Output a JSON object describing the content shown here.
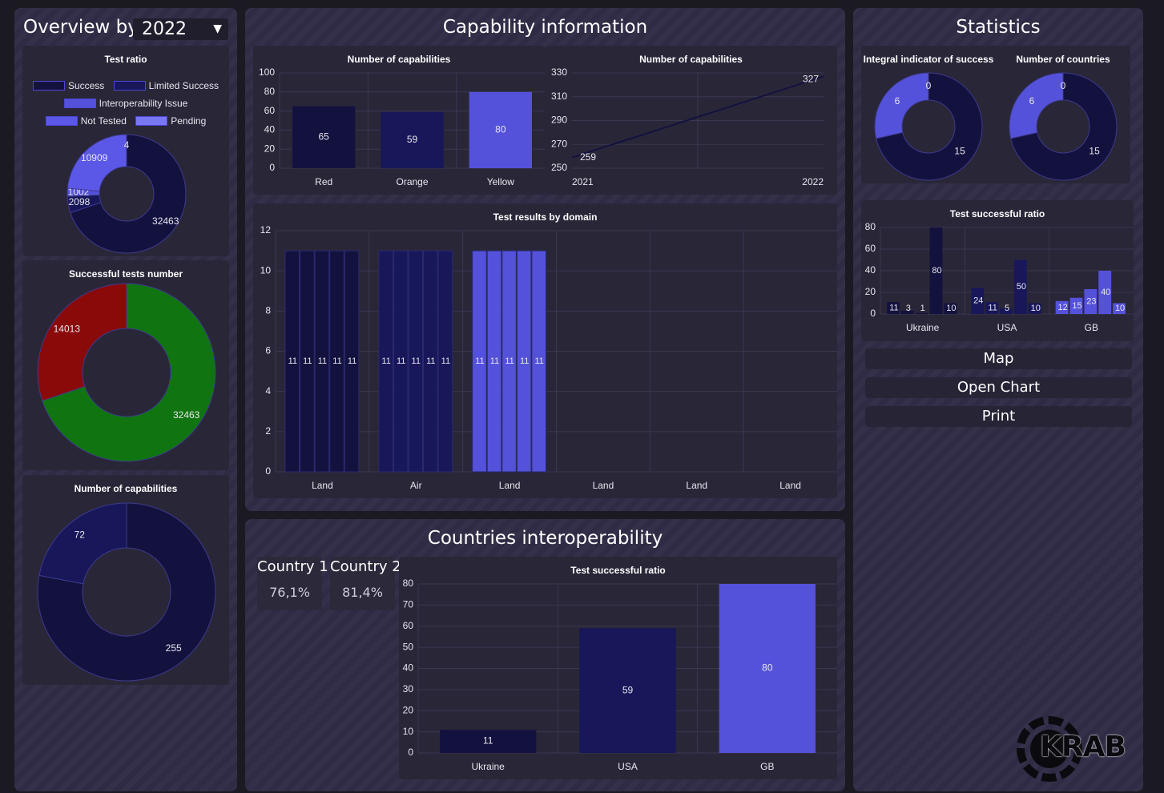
{
  "left": {
    "overview_label": "Overview by",
    "year": "2022"
  },
  "capability": {
    "title": "Capability information"
  },
  "countries": {
    "title": "Countries interoperability",
    "kpis": [
      {
        "label": "Country 1",
        "value": "76,1%"
      },
      {
        "label": "Country 2",
        "value": "81,4%"
      }
    ]
  },
  "statistics": {
    "title": "Statistics",
    "buttons": {
      "map": "Map",
      "open_chart": "Open Chart",
      "print": "Print"
    }
  },
  "logo": {
    "text": "KRAB"
  },
  "colors": {
    "dark_navy": "#13123f",
    "navy": "#17175a",
    "purple": "#5452da",
    "light_purple": "#6a67f0",
    "green": "#107510",
    "red": "#8a0a0a"
  },
  "chart_data": [
    {
      "id": "test_ratio",
      "type": "pie",
      "title": "Test ratio",
      "legend": [
        "Success",
        "Limited Success",
        "Interoperability Issue",
        "Not Tested",
        "Pending"
      ],
      "labels": [
        "Success",
        "Limited Success",
        "Interoperability Issue",
        "Not Tested",
        "Pending"
      ],
      "values": [
        32463,
        2098,
        1002,
        10909,
        4
      ],
      "colors": [
        "#13123f",
        "#17175a",
        "#5452da",
        "#5b58e8",
        "#7a77f2"
      ]
    },
    {
      "id": "successful_tests",
      "type": "pie",
      "title": "Successful tests number",
      "labels": [
        "",
        ""
      ],
      "values": [
        32463,
        14013
      ],
      "colors": [
        "#107510",
        "#8a0a0a"
      ]
    },
    {
      "id": "capabilities_donut",
      "type": "pie",
      "title": "Number of capabilities",
      "labels": [
        "",
        ""
      ],
      "values": [
        255,
        72
      ],
      "colors": [
        "#13123f",
        "#17175a"
      ]
    },
    {
      "id": "capabilities_bar",
      "type": "bar",
      "title": "Number of capabilities",
      "categories": [
        "Red",
        "Orange",
        "Yellow"
      ],
      "values": [
        65,
        59,
        80
      ],
      "colors": [
        "#13123f",
        "#17175a",
        "#5452da"
      ],
      "ylim": [
        0,
        100
      ],
      "yticks": [
        0,
        20,
        40,
        60,
        80,
        100
      ]
    },
    {
      "id": "capabilities_line",
      "type": "line",
      "title": "Number of capabilities",
      "x": [
        "2021",
        "2022"
      ],
      "values": [
        259,
        327
      ],
      "ylim": [
        250,
        330
      ],
      "yticks": [
        250,
        270,
        290,
        310,
        330
      ]
    },
    {
      "id": "test_results_domain",
      "type": "bar",
      "title": "Test results by domain",
      "categories": [
        "Land",
        "Air",
        "Land",
        "Land",
        "Land",
        "Land"
      ],
      "groups": [
        {
          "values": [
            11,
            11,
            11,
            11,
            11
          ],
          "color": "#13123f"
        },
        {
          "values": [
            11,
            11,
            11,
            11,
            11
          ],
          "color": "#17175a"
        },
        {
          "values": [
            11,
            11,
            11,
            11,
            11
          ],
          "color": "#5452da"
        },
        {
          "values": [],
          "color": "#13123f"
        },
        {
          "values": [],
          "color": "#13123f"
        },
        {
          "values": [],
          "color": "#13123f"
        }
      ],
      "ylim": [
        0,
        12
      ],
      "yticks": [
        0,
        2,
        4,
        6,
        8,
        10,
        12
      ]
    },
    {
      "id": "integral_indicator",
      "type": "pie",
      "title": "Integral indicator of success",
      "labels": [
        "",
        "",
        ""
      ],
      "values": [
        15,
        6,
        0
      ],
      "colors": [
        "#13123f",
        "#5452da",
        "#17175a"
      ]
    },
    {
      "id": "number_countries",
      "type": "pie",
      "title": "Number of countries",
      "labels": [
        "",
        "",
        ""
      ],
      "values": [
        15,
        6,
        0
      ],
      "colors": [
        "#13123f",
        "#5452da",
        "#17175a"
      ]
    },
    {
      "id": "test_success_small",
      "type": "bar",
      "title": "Test successful ratio",
      "categories": [
        "Ukraine",
        "USA",
        "GB"
      ],
      "groups": [
        {
          "values": [
            11,
            3,
            1,
            80,
            10
          ],
          "colors": [
            "#13123f",
            "#13123f",
            "#13123f",
            "#13123f",
            "#13123f"
          ]
        },
        {
          "values": [
            24,
            11,
            5,
            50,
            10
          ],
          "colors": [
            "#17175a",
            "#17175a",
            "#17175a",
            "#17175a",
            "#17175a"
          ]
        },
        {
          "values": [
            12,
            15,
            23,
            40,
            10
          ],
          "colors": [
            "#5452da",
            "#5452da",
            "#5452da",
            "#5452da",
            "#5452da"
          ]
        }
      ],
      "ylim": [
        0,
        80
      ],
      "yticks": [
        0,
        20,
        40,
        60,
        80
      ]
    },
    {
      "id": "test_success_large",
      "type": "bar",
      "title": "Test successful ratio",
      "categories": [
        "Ukraine",
        "USA",
        "GB"
      ],
      "values": [
        11,
        59,
        80
      ],
      "colors": [
        "#13123f",
        "#17175a",
        "#5452da"
      ],
      "ylim": [
        0,
        80
      ],
      "yticks": [
        0,
        10,
        20,
        30,
        40,
        50,
        60,
        70,
        80
      ]
    }
  ]
}
